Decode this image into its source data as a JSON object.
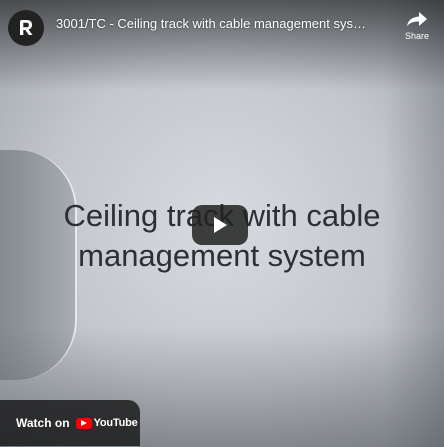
{
  "video": {
    "title": "3001/TC - Ceiling track with cable management system",
    "caption_line1": "Ceiling track with cable",
    "caption_line2": "management system"
  },
  "topbar": {
    "share_label": "Share"
  },
  "footer": {
    "watch_on_label": "Watch on",
    "youtube_label": "YouTube"
  },
  "icons": {
    "channel": "channel-logo-icon",
    "share": "share-arrow-icon",
    "play": "play-icon",
    "youtube": "youtube-logo-icon"
  },
  "colors": {
    "play_button": "#212121",
    "youtube_red": "#ff0000",
    "channel_avatar": "#222222"
  }
}
